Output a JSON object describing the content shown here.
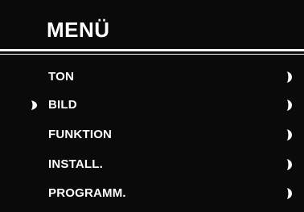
{
  "menu": {
    "title": "MENÜ",
    "selected_index": 1,
    "items": [
      {
        "label": "TON",
        "submenu_icon": "chevron-right-icon"
      },
      {
        "label": "BILD",
        "submenu_icon": "chevron-right-icon"
      },
      {
        "label": "FUNKTION",
        "submenu_icon": "chevron-right-icon"
      },
      {
        "label": "INSTALL.",
        "submenu_icon": "chevron-right-icon"
      },
      {
        "label": "PROGRAMM.",
        "submenu_icon": "chevron-right-icon"
      }
    ],
    "cursor_icon": "selection-pointer-icon",
    "colors": {
      "background": "#0a0a0a",
      "text": "#ffffff"
    }
  }
}
